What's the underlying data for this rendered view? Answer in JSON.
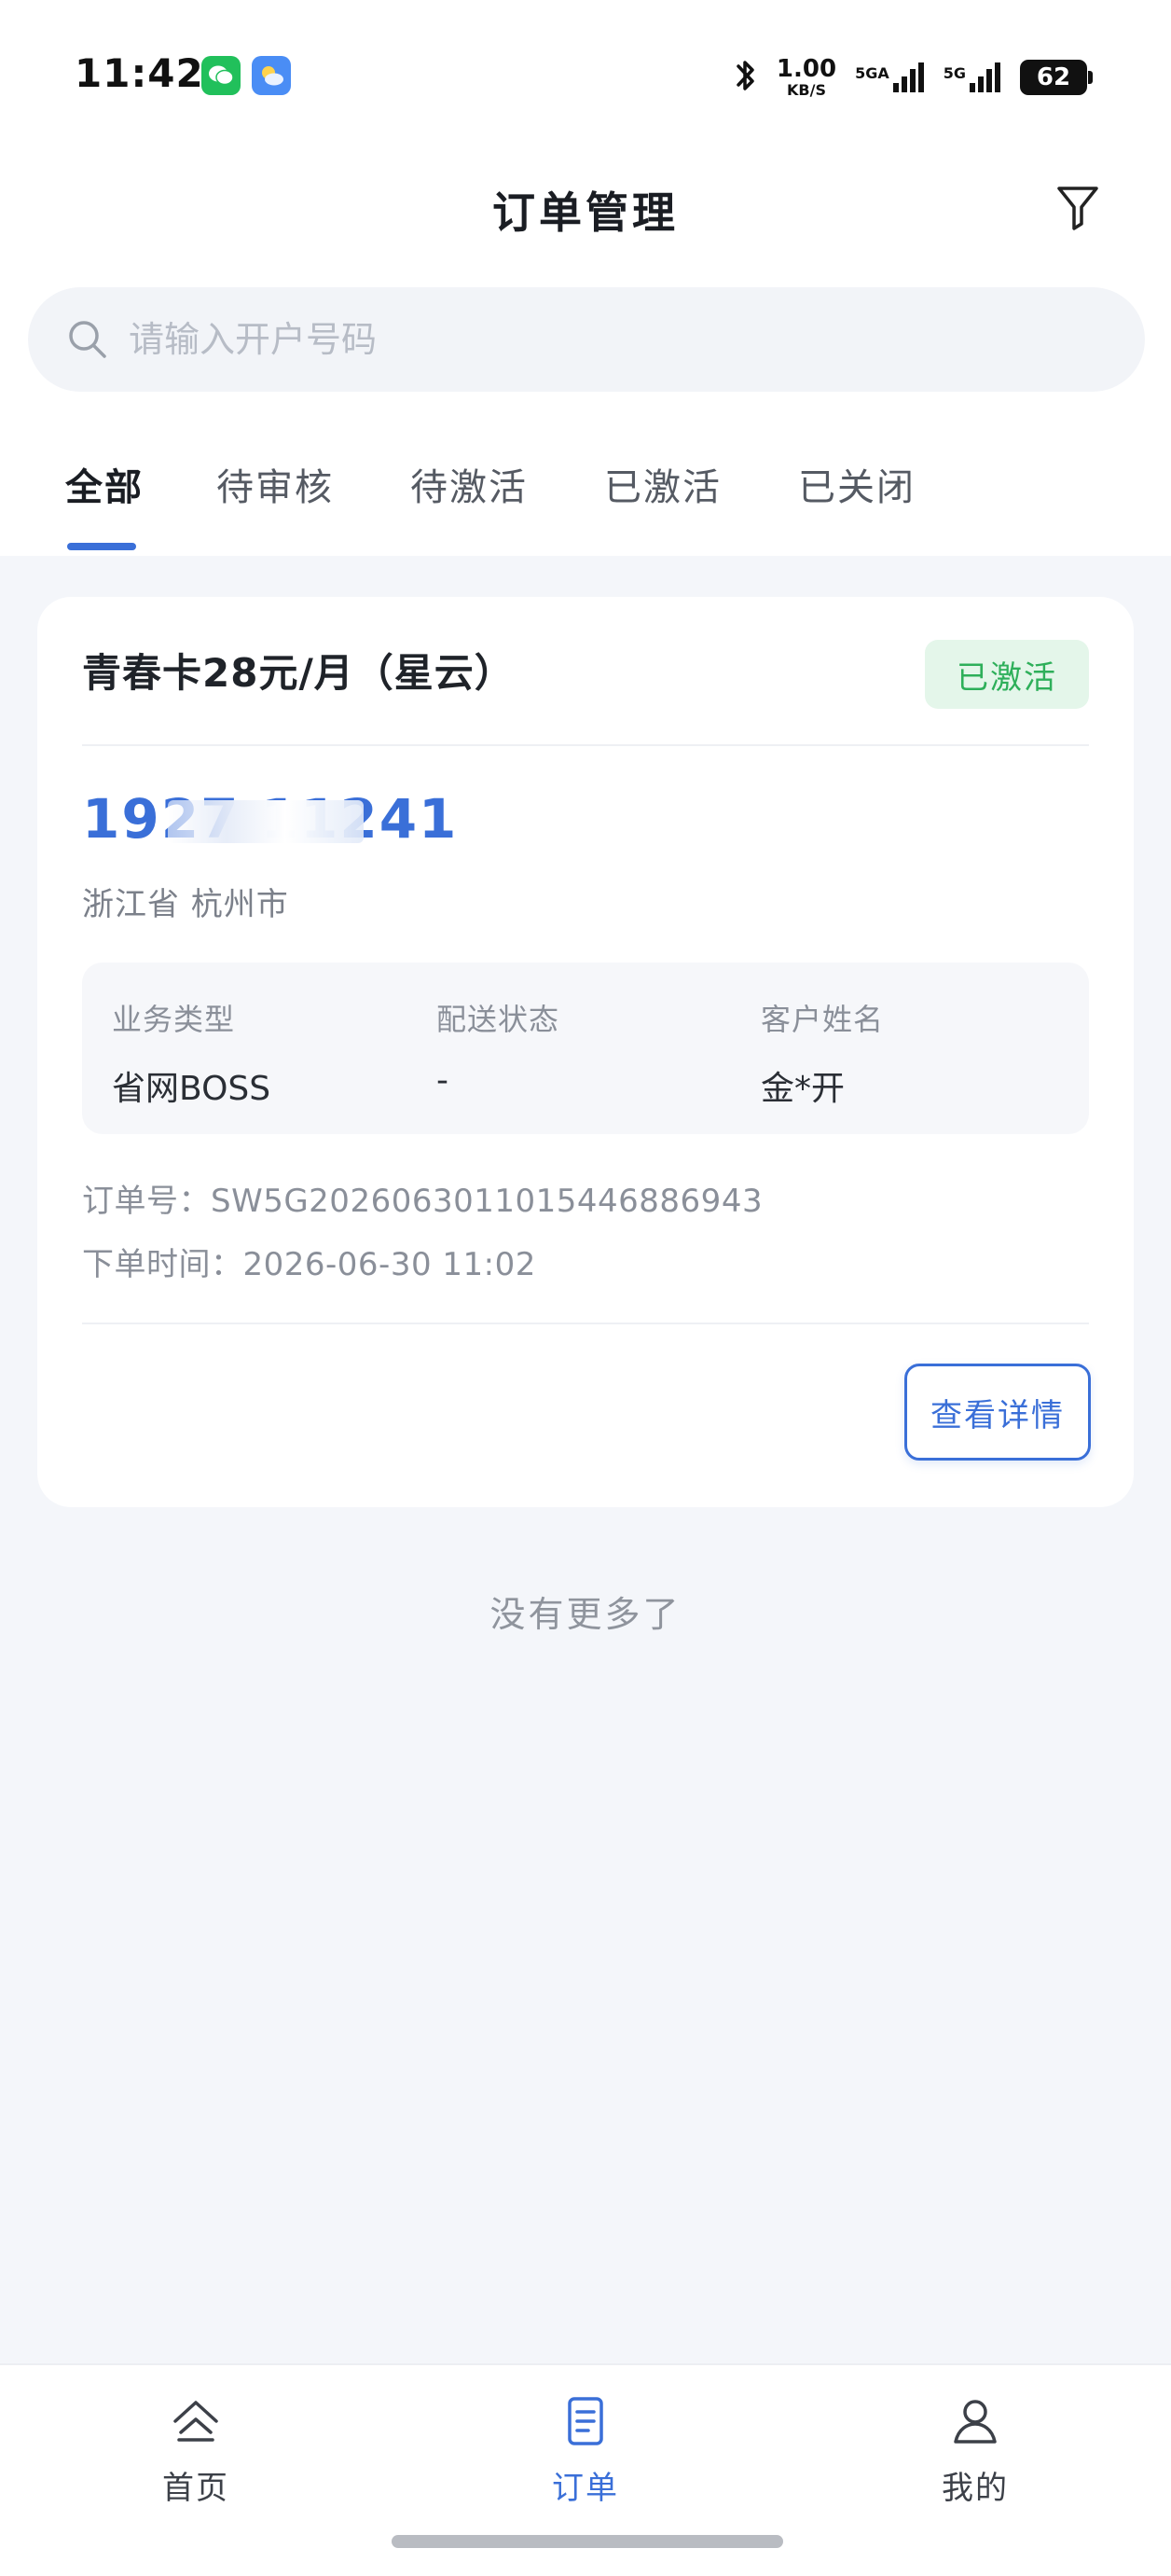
{
  "status_bar": {
    "time": "11:42",
    "net_speed": "1.00",
    "net_unit": "KB/S",
    "signal1_label": "5G",
    "signal1_sub": "A",
    "signal2_label": "5G",
    "battery": "62",
    "icons": [
      "wechat-icon",
      "weather-icon",
      "bluetooth-icon",
      "signal-icon",
      "battery-icon"
    ]
  },
  "header": {
    "title": "订单管理",
    "filter_icon": "filter-icon"
  },
  "search": {
    "placeholder": "请输入开户号码",
    "value": ""
  },
  "tabs": [
    {
      "label": "全部",
      "active": true
    },
    {
      "label": "待审核",
      "active": false
    },
    {
      "label": "待激活",
      "active": false
    },
    {
      "label": "已激活",
      "active": false
    },
    {
      "label": "已关闭",
      "active": false
    }
  ],
  "order": {
    "title": "青春卡28元/月（星云）",
    "status": "已激活",
    "phone": "1927   11241",
    "region": "浙江省 杭州市",
    "fields": [
      {
        "label": "业务类型",
        "value": "省网BOSS"
      },
      {
        "label": "配送状态",
        "value": "-"
      },
      {
        "label": "客户姓名",
        "value": "金*开"
      }
    ],
    "order_no": "订单号：SW5G20260630110154468869​43",
    "order_time": "下单时间：2026-06-30 11:02",
    "detail_button": "查看详情"
  },
  "list_end": "没有更多了",
  "colors": {
    "accent": "#3a6fd8",
    "status_green": "#2eaf5a",
    "status_green_bg": "#e4f6ea",
    "page_bg": "#f4f6fa"
  },
  "bottom_nav": [
    {
      "label": "首页",
      "icon": "home-icon",
      "active": false
    },
    {
      "label": "订单",
      "icon": "order-icon",
      "active": true
    },
    {
      "label": "我的",
      "icon": "user-icon",
      "active": false
    }
  ]
}
